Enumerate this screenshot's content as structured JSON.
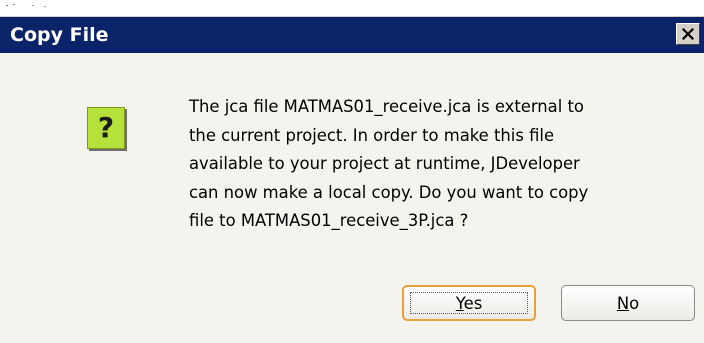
{
  "dialog": {
    "title": "Copy File",
    "icon": "question-mark-icon",
    "icon_glyph": "?",
    "message_lines": [
      "The jca file MATMAS01_receive.jca is external to",
      "the current project. In order to make this file",
      "available to your project at runtime, JDeveloper",
      "can now make a local copy. Do you want to copy",
      "file to MATMAS01_receive_3P.jca ?"
    ],
    "close_glyph": "✕",
    "buttons": {
      "yes": {
        "mnemonic": "Y",
        "rest": "es"
      },
      "no": {
        "mnemonic": "N",
        "rest": "o"
      }
    }
  },
  "colors": {
    "titlebar": "#0b2469",
    "dialog_background": "#f4f3ee",
    "icon_background": "#b6e03a",
    "default_button_border": "#e7a03a"
  }
}
